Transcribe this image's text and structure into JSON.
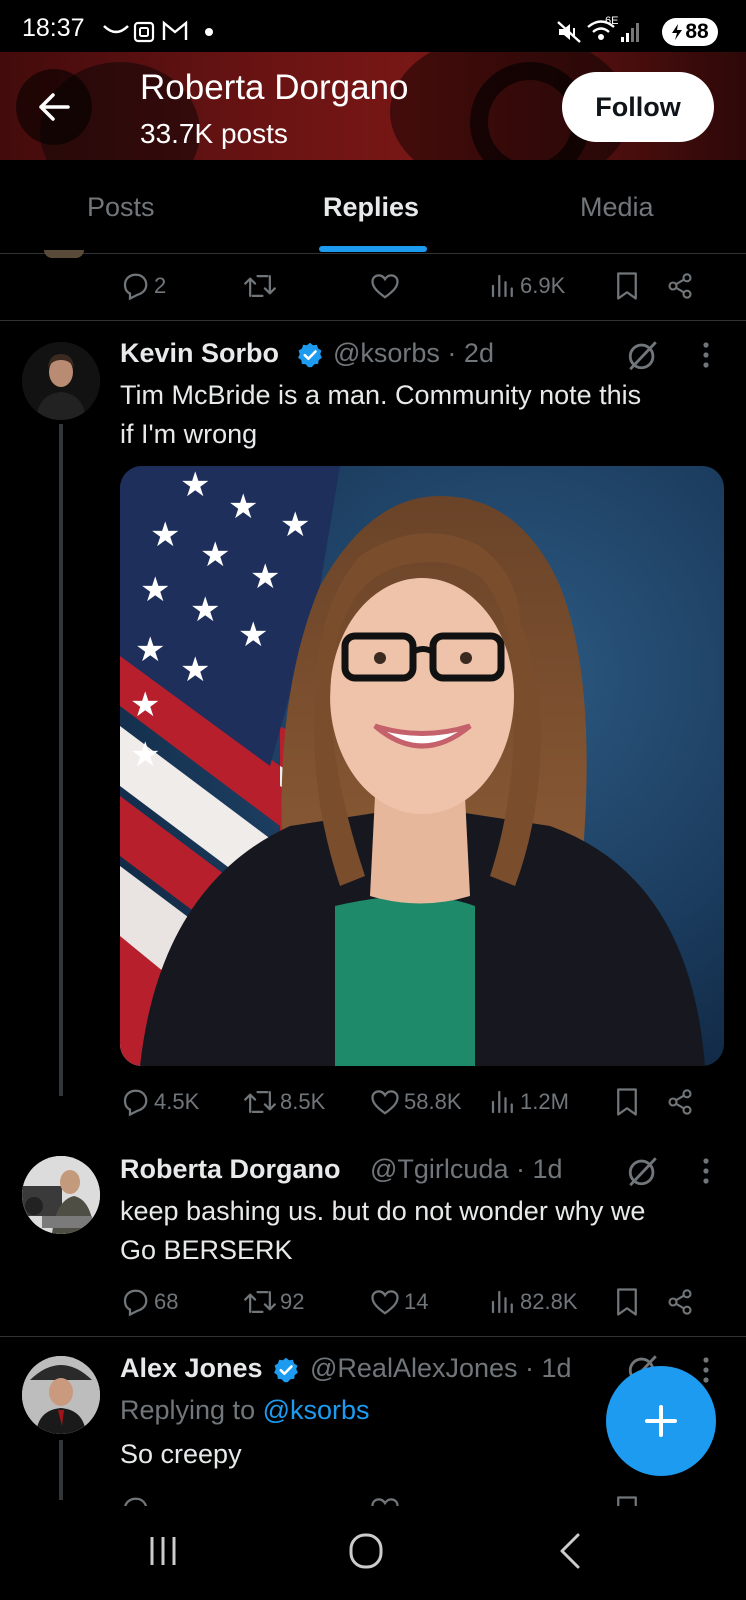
{
  "status_bar": {
    "time": "18:37",
    "battery": "88",
    "network_label": "6E"
  },
  "header": {
    "name": "Roberta Dorgano",
    "posts": "33.7K posts",
    "follow_label": "Follow"
  },
  "tabs": [
    {
      "label": "Posts"
    },
    {
      "label": "Replies"
    },
    {
      "label": "Media"
    }
  ],
  "top_actions": {
    "replies": "2",
    "views": "6.9K"
  },
  "tweets": [
    {
      "name": "Kevin Sorbo",
      "verified": true,
      "handle": "@ksorbs · 2d",
      "text_line1": "Tim McBride is a man. Community note this",
      "text_line2": "if I'm wrong",
      "replies": "4.5K",
      "reposts": "8.5K",
      "likes": "58.8K",
      "views": "1.2M"
    },
    {
      "name": "Roberta Dorgano",
      "verified": false,
      "handle": "@Tgirlcuda · 1d",
      "text_line1": "keep bashing us. but do not wonder why we",
      "text_line2": "Go BERSERK",
      "replies": "68",
      "reposts": "92",
      "likes": "14",
      "views": "82.8K"
    },
    {
      "name": "Alex Jones",
      "verified": true,
      "handle": "@RealAlexJones · 1d",
      "replying_prefix": "Replying to ",
      "replying_handle": "@ksorbs",
      "text_line1": "So creepy"
    }
  ],
  "colors": {
    "accent": "#1d9bf0",
    "muted": "#71767b",
    "divider": "#2f3336",
    "background": "#000000"
  },
  "icons": [
    "back-arrow-icon",
    "reply-icon",
    "repost-icon",
    "like-icon",
    "views-icon",
    "bookmark-icon",
    "share-icon",
    "grok-icon",
    "more-icon",
    "verified-icon",
    "compose-plus-icon"
  ]
}
